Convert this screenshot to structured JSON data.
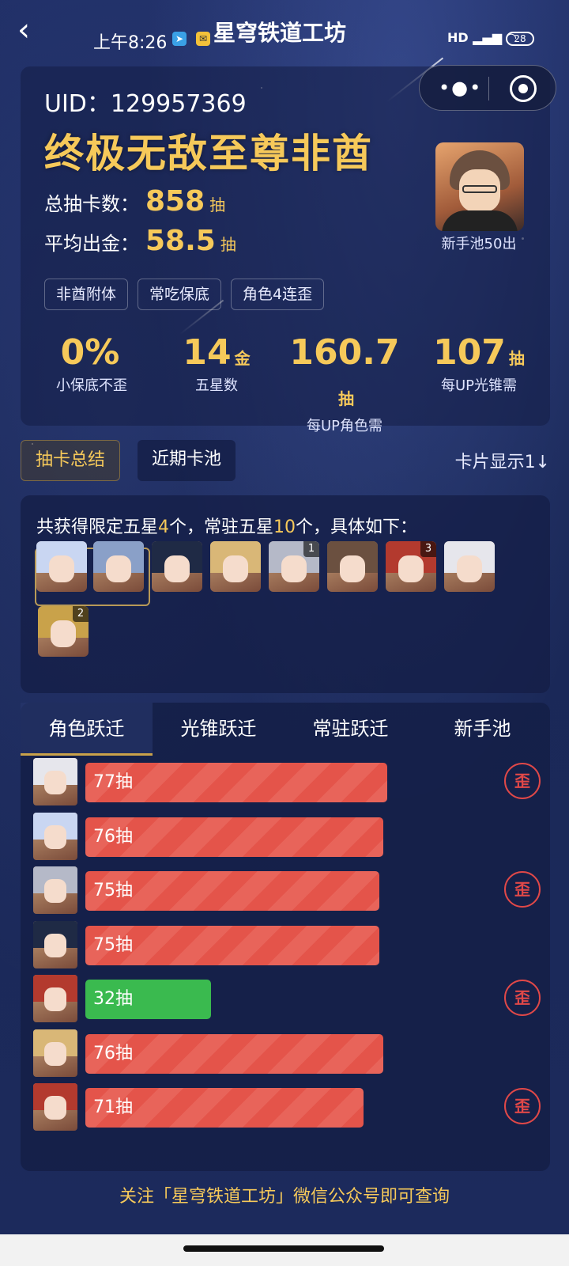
{
  "status": {
    "time": "上午8:26",
    "app_title": "星穹铁道工坊",
    "signal": "HD",
    "battery": "28"
  },
  "profile": {
    "uid_label": "UID：",
    "uid": "129957369",
    "nickname": "终极无敌至尊非酋",
    "total_label": "总抽卡数：",
    "total_value": "858",
    "avg_label": "平均出金：",
    "avg_value": "58.5",
    "unit_pull": "抽",
    "avatar_caption": "新手池50出",
    "tags": [
      "非酋附体",
      "常吃保底",
      "角色4连歪"
    ]
  },
  "stats": [
    {
      "value": "0%",
      "unit": "",
      "label": "小保底不歪"
    },
    {
      "value": "14",
      "unit": "金",
      "label": "五星数"
    },
    {
      "value": "160.7",
      "unit": "抽",
      "label": "每UP角色需"
    },
    {
      "value": "107",
      "unit": "抽",
      "label": "每UP光锥需"
    }
  ],
  "tabs": {
    "summary": "抽卡总结",
    "recent": "近期卡池",
    "sort": "卡片显示1↓"
  },
  "summary": {
    "p1": "共获得限定五星",
    "limited": "4",
    "p2": "个，常驻五星",
    "standard": "10",
    "p3": "个，具体如下："
  },
  "thumbs": [
    {
      "badge": "",
      "hair": "#c9d6f2"
    },
    {
      "badge": "",
      "hair": "#8aa0c8"
    },
    {
      "badge": "",
      "hair": "#1f2a45"
    },
    {
      "badge": "",
      "hair": "#d9b777"
    },
    {
      "badge": "1",
      "hair": "#b5b9c8"
    },
    {
      "badge": "",
      "hair": "#6b5040"
    },
    {
      "badge": "3",
      "hair": "#b33a2e"
    },
    {
      "badge": "",
      "hair": "#e6e6ec"
    },
    {
      "badge": "2",
      "hair": "#c9a24a"
    }
  ],
  "warp_tabs": [
    "角色跃迁",
    "光锥跃迁",
    "常驻跃迁",
    "新手池"
  ],
  "rows": [
    {
      "label": "77抽",
      "pulls": 77,
      "waiji": true,
      "green": false,
      "hair": "#e6e6ec"
    },
    {
      "label": "76抽",
      "pulls": 76,
      "waiji": false,
      "green": false,
      "hair": "#c9d6f2"
    },
    {
      "label": "75抽",
      "pulls": 75,
      "waiji": true,
      "green": false,
      "hair": "#b5b9c8"
    },
    {
      "label": "75抽",
      "pulls": 75,
      "waiji": false,
      "green": false,
      "hair": "#1f2a45"
    },
    {
      "label": "32抽",
      "pulls": 32,
      "waiji": true,
      "green": true,
      "hair": "#b33a2e"
    },
    {
      "label": "76抽",
      "pulls": 76,
      "waiji": false,
      "green": false,
      "hair": "#d9b777"
    },
    {
      "label": "71抽",
      "pulls": 71,
      "waiji": true,
      "green": false,
      "hair": "#b33a2e"
    }
  ],
  "waiji_text": "歪",
  "footer": "关注「星穹铁道工坊」微信公众号即可查询",
  "colors": {
    "gold": "#f6c95a",
    "red": "#e4544a",
    "green": "#3aba4f"
  }
}
